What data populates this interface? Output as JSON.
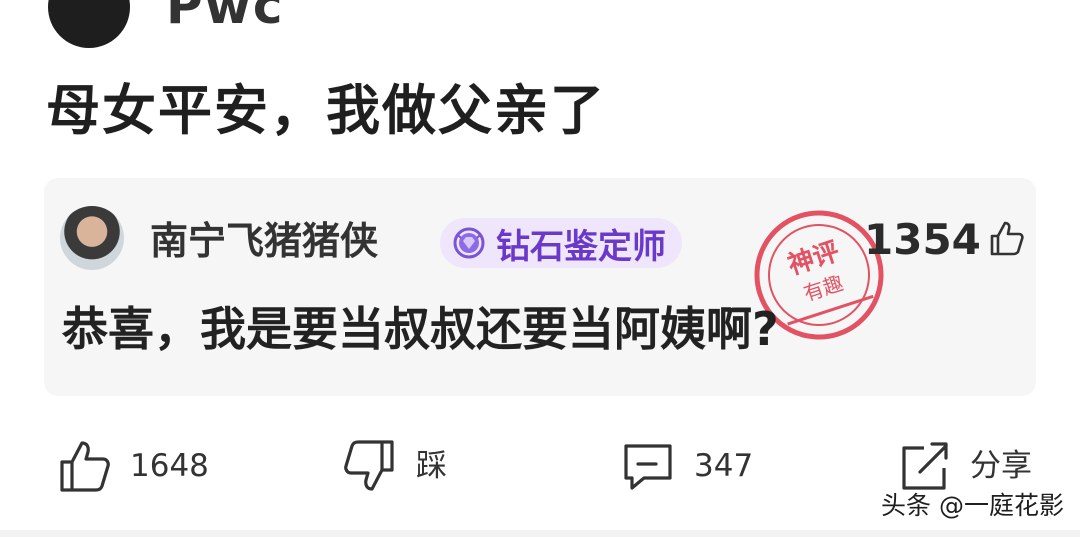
{
  "post": {
    "author_partial": "Pwc",
    "text": "母女平安，我做父亲了"
  },
  "comment": {
    "username": "南宁飞猪猪侠",
    "badge": "钻石鉴定师",
    "likes": "1354",
    "text": "恭喜，我是要当叔叔还要当阿姨啊?",
    "stamp": {
      "top": "神评",
      "middle": "有趣"
    }
  },
  "actions": {
    "like_count": "1648",
    "dislike_label": "踩",
    "comment_count": "347",
    "share_label": "分享"
  },
  "watermark": "头条 @一庭花影",
  "colors": {
    "badge_text": "#6a39c9",
    "badge_bg": "#efe6fb",
    "stamp": "#e0364a",
    "card_bg": "#f6f6f6"
  }
}
